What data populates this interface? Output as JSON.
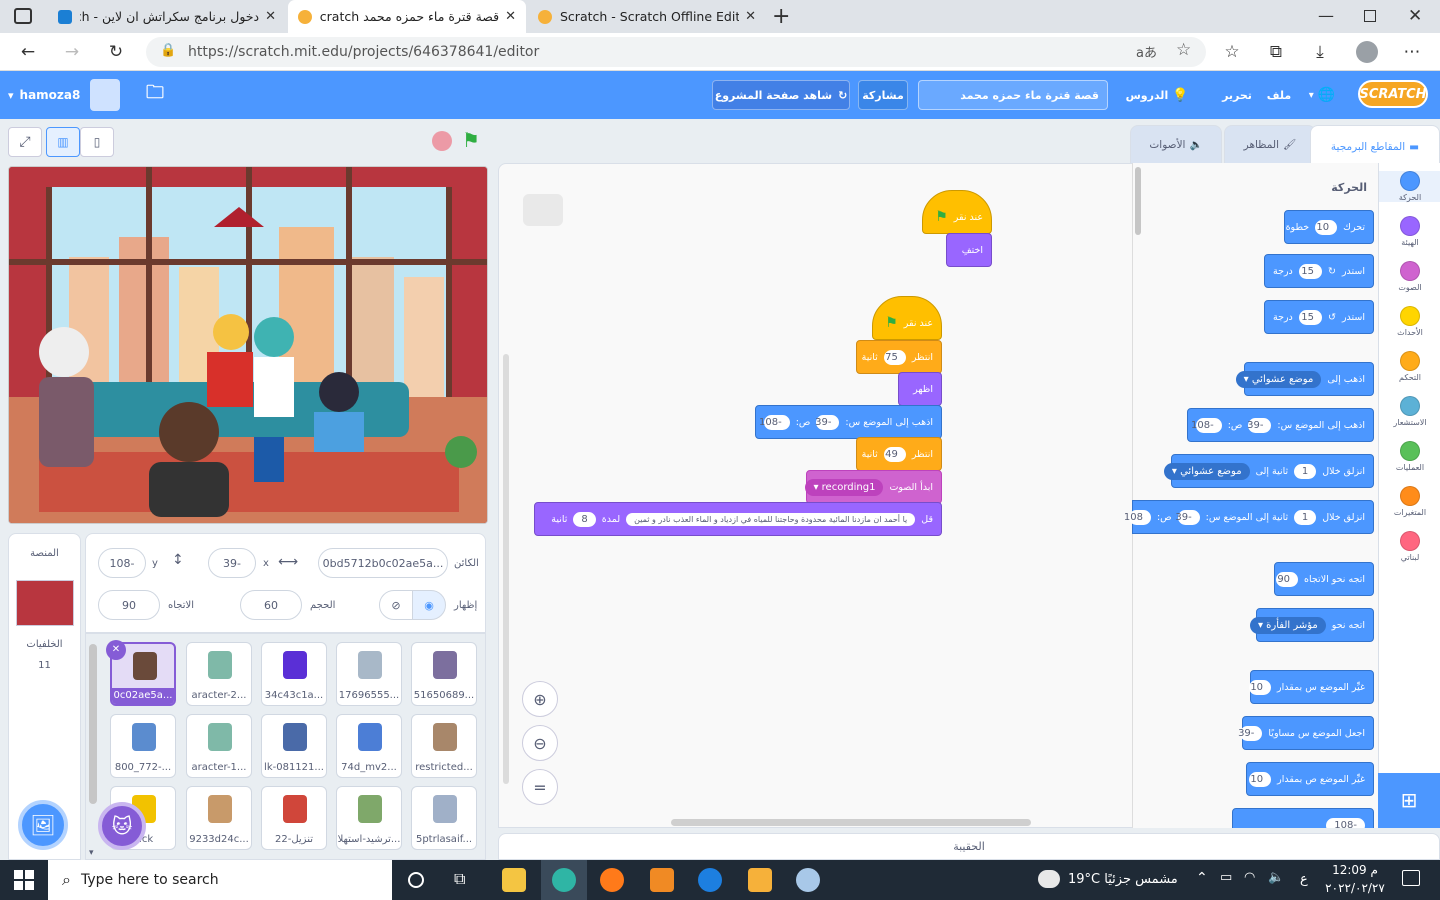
{
  "browser": {
    "tabs": [
      {
        "title": "دخول برنامج سكراتش ان لاين - Search",
        "display": "دخول برنامج سكراتش ان لاين - ‎ch"
      },
      {
        "title": "قصة قترة ماء حمزه محمد on Scratch"
      },
      {
        "title": "Scratch - Scratch Offline Editor"
      }
    ],
    "url": "https://scratch.mit.edu/projects/646378641/editor"
  },
  "menu": {
    "logo": "SCRATCH",
    "file": "ملف",
    "edit": "تحرير",
    "tutorials": "الدروس",
    "project_title": "قصة قترة ماء حمزه محمد",
    "share": "مشاركة",
    "see_project_page": "شاهد صفحة المشروع",
    "username": "hamoza8"
  },
  "editor_tabs": {
    "code": "المقاطع البرمجية",
    "costumes": "المظاهر",
    "sounds": "الأصوات"
  },
  "categories": [
    {
      "name": "الحركة",
      "color": "#4c97ff"
    },
    {
      "name": "الهيئة",
      "color": "#9966ff"
    },
    {
      "name": "الصوت",
      "color": "#cf63cf"
    },
    {
      "name": "الأحداث",
      "color": "#ffd500"
    },
    {
      "name": "التحكم",
      "color": "#ffab19"
    },
    {
      "name": "الاستشعار",
      "color": "#5cb1d6"
    },
    {
      "name": "العمليات",
      "color": "#59c059"
    },
    {
      "name": "المتغيرات",
      "color": "#ff8c1a"
    },
    {
      "name": "لبناتي",
      "color": "#ff6680"
    }
  ],
  "palette": {
    "heading": "الحركة",
    "move": {
      "pre": "تحرك",
      "val": "10",
      "post": "خطوة"
    },
    "turn_right": {
      "pre": "استدر",
      "val": "15",
      "post": "درجة"
    },
    "turn_left": {
      "pre": "استدر",
      "val": "15",
      "post": "درجة"
    },
    "goto": {
      "pre": "اذهب إلى",
      "drop": "موضع عشوائي"
    },
    "goto_xy": {
      "pre": "اذهب إلى الموضع س:",
      "x": "-39",
      "mid": "ص:",
      "y": "-108"
    },
    "glide": {
      "pre": "انزلق خلال",
      "val": "1",
      "mid": "ثانية إلى",
      "drop": "موضع عشوائي"
    },
    "glide_xy": {
      "pre": "انزلق خلال",
      "val": "1",
      "mid": "ثانية إلى الموضع س:",
      "x": "-39",
      "mid2": "ص:",
      "y": "108"
    },
    "point_dir": {
      "pre": "اتجه نحو الاتجاه",
      "val": "90"
    },
    "point_towards": {
      "pre": "اتجه نحو",
      "drop": "مؤشر الفأرة"
    },
    "change_x": {
      "pre": "غيِّر الموضع س بمقدار",
      "val": "10"
    },
    "set_x": {
      "pre": "اجعل الموضع س مساويًا",
      "val": "-39"
    },
    "change_y": {
      "pre": "غيِّر الموضع ص بمقدار",
      "val": "10"
    },
    "partial_last": "-108"
  },
  "scripts": {
    "when_flag": "عند نقر",
    "hide": "اختفِ",
    "wait": "انتظر",
    "wait1": "75",
    "seconds": "ثانية",
    "show": "اظهر",
    "goto_xy": "اذهب إلى الموضع س:",
    "x": "-39",
    "y_label": "ص:",
    "y": "-108",
    "wait2": "49",
    "start_sound": "ابدأ الصوت",
    "sound_name": "recording1",
    "say": "قل",
    "say_text": "يا أحمد ان مازدنا المائية محدودة وحاجتنا للمياه في ازدياد و الماء العذب نادر و ثمين",
    "for": "لمدة",
    "say_secs": "8",
    "say_unit": "ثانية"
  },
  "sprite_info": {
    "label_sprite": "الكائن",
    "sprite_name": "0bd5712b0c02ae5a...",
    "x_label": "x",
    "x": "39-",
    "y_label": "y",
    "y": "108-",
    "show_label": "إظهار",
    "size_label": "الحجم",
    "size": "60",
    "direction_label": "الاتجاه",
    "direction": "90"
  },
  "sprites": [
    {
      "name": "0c02ae5a...",
      "color": "#6a4a3a"
    },
    {
      "name": "aracter-2...",
      "color": "#7fb9a8"
    },
    {
      "name": "34c43c1a...",
      "color": "#5a2fd6"
    },
    {
      "name": "17696555...",
      "color": "#a8b8c8"
    },
    {
      "name": "51650689...",
      "color": "#7c6f9e"
    },
    {
      "name": "800_772-...",
      "color": "#5b8ccf"
    },
    {
      "name": "aracter-1...",
      "color": "#7fb9a8"
    },
    {
      "name": "lk-081121...",
      "color": "#4a6aa8"
    },
    {
      "name": "74d_mv2...",
      "color": "#4c7ed6"
    },
    {
      "name": "restricted...",
      "color": "#a8876a"
    },
    {
      "name": "hick",
      "color": "#f2c200"
    },
    {
      "name": "9233d24c...",
      "color": "#c89a6a"
    },
    {
      "name": "تنزيل-22",
      "color": "#d0463a"
    },
    {
      "name": "ترشيد-استهلا...",
      "color": "#7fa86a"
    },
    {
      "name": "5ptrlasaif...",
      "color": "#a0b0c8"
    }
  ],
  "stage_panel": {
    "label": "المنصة",
    "backdrops_label": "الخلفيات",
    "backdrops_count": "11"
  },
  "backpack": "الحقيبة",
  "taskbar": {
    "search_placeholder": "Type here to search",
    "weather": "19°C  مشمس جزئيًا",
    "time": "12:09 م",
    "date": "٢٠٢٢/٠٢/٢٧",
    "lang": "ع"
  }
}
